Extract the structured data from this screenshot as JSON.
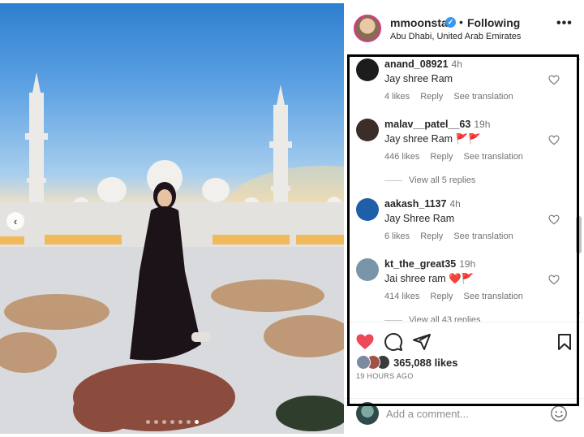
{
  "post": {
    "username": "mmoonstar",
    "separator": "•",
    "follow_status": "Following",
    "location": "Abu Dhabi, United Arab Emirates",
    "more_label": "•••",
    "verified_mark": "✓",
    "carousel": {
      "prev_label": "‹",
      "dot_count": 7,
      "active_dot": 6
    }
  },
  "comments": [
    {
      "username": "anand_08921",
      "time": "4h",
      "text": "Jay shree Ram",
      "likes": "4 likes",
      "reply": "Reply",
      "translate": "See translation",
      "avatar_color": "#1c1c1c",
      "avatar_icon": "mask-avatar"
    },
    {
      "username": "malav__patel__63",
      "time": "19h",
      "text": "Jay shree Ram 🚩🚩",
      "likes": "446 likes",
      "reply": "Reply",
      "translate": "See translation",
      "avatar_color": "#3b2e28",
      "avatar_icon": "person-avatar",
      "view_replies": "View all 5 replies"
    },
    {
      "username": "aakash_1137",
      "time": "4h",
      "text": "Jay Shree Ram",
      "likes": "6 likes",
      "reply": "Reply",
      "translate": "See translation",
      "avatar_color": "#1f5fa8",
      "avatar_icon": "deity-avatar"
    },
    {
      "username": "kt_the_great35",
      "time": "19h",
      "text": "Jai shree ram ❤️🚩",
      "likes": "414 likes",
      "reply": "Reply",
      "translate": "See translation",
      "avatar_color": "#7a94a8",
      "avatar_icon": "person-avatar",
      "view_replies": "View all 43 replies"
    }
  ],
  "actions": {
    "like_icon": "heart-filled-icon",
    "comment_icon": "comment-icon",
    "share_icon": "share-icon",
    "save_icon": "bookmark-icon",
    "like_color": "#ed4956"
  },
  "likes": {
    "count": "365,088 likes",
    "avatar_colors": [
      "#7a8aa0",
      "#a0524a",
      "#3b3b3b"
    ]
  },
  "posted_time": "19 HOURS AGO",
  "add_comment": {
    "placeholder": "Add a comment...",
    "emoji_icon": "smiley-icon"
  }
}
